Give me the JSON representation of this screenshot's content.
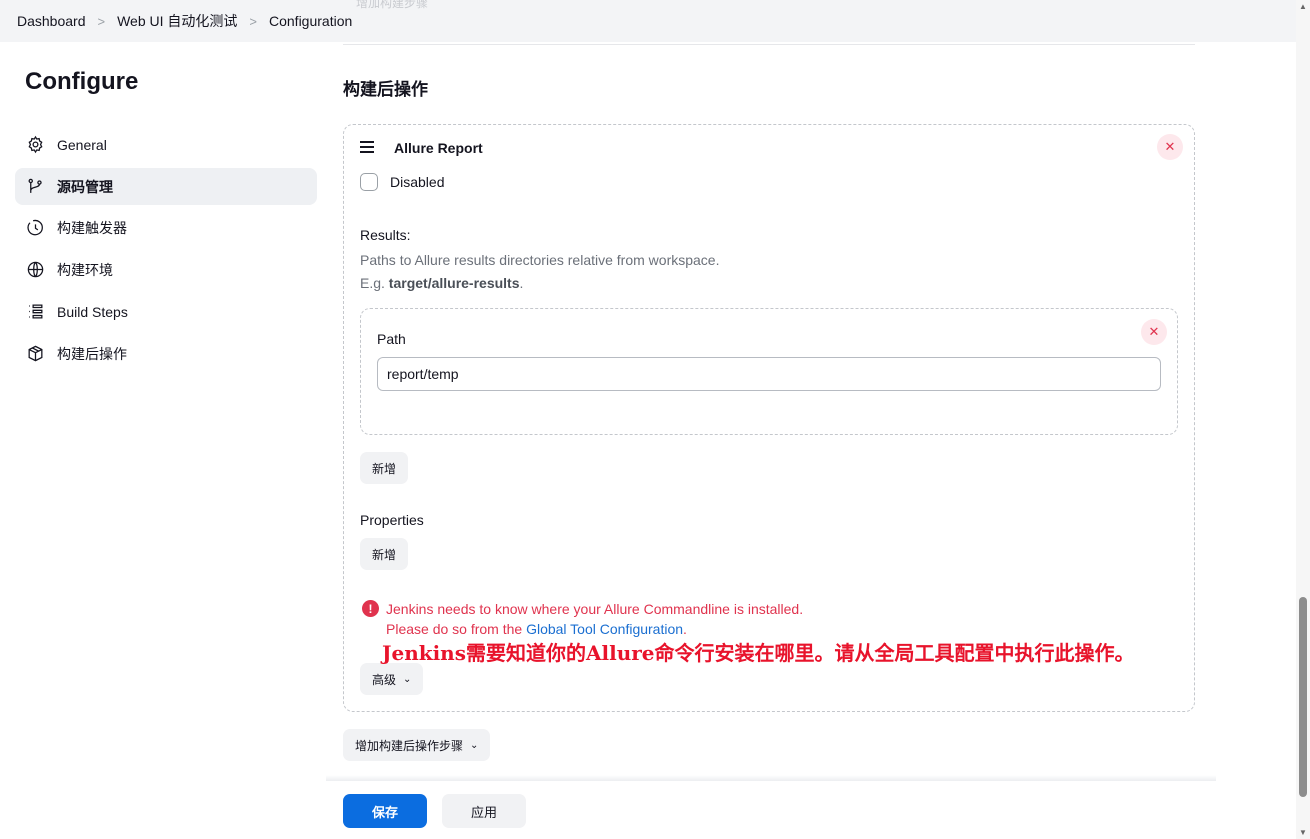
{
  "breadcrumb": {
    "items": [
      "Dashboard",
      "Web UI 自动化测试",
      "Configuration"
    ],
    "separator": ">"
  },
  "top_faint_text": "增加构建步骤",
  "sidebar": {
    "title": "Configure",
    "items": [
      {
        "label": "General",
        "icon": "gear-icon",
        "active": false
      },
      {
        "label": "源码管理",
        "icon": "branch-icon",
        "active": true
      },
      {
        "label": "构建触发器",
        "icon": "clock-icon",
        "active": false
      },
      {
        "label": "构建环境",
        "icon": "globe-icon",
        "active": false
      },
      {
        "label": "Build Steps",
        "icon": "list-icon",
        "active": false
      },
      {
        "label": "构建后操作",
        "icon": "package-icon",
        "active": false
      }
    ]
  },
  "main": {
    "section_title": "构建后操作",
    "allure": {
      "title": "Allure Report",
      "disabled_label": "Disabled",
      "disabled_checked": false,
      "results_label": "Results:",
      "results_help": "Paths to Allure results directories relative from workspace.",
      "example_prefix": "E.g. ",
      "example_value": "target/allure-results",
      "example_suffix": ".",
      "path_label": "Path",
      "path_value": "report/temp",
      "add_path_button": "新增",
      "properties_label": "Properties",
      "add_property_button": "新增",
      "error_line1": "Jenkins needs to know where your Allure Commandline is installed.",
      "error_line2_prefix": "Please do so from the ",
      "error_link": "Global Tool Configuration",
      "error_line2_suffix": ".",
      "advanced_button": "高级"
    },
    "annotation": "Jenkins需要知道你的Allure命令行安装在哪里。请从全局工具配置中执行此操作。",
    "add_post_build_button": "增加构建后操作步骤"
  },
  "footer": {
    "save_label": "保存",
    "apply_label": "应用"
  },
  "colors": {
    "primary": "#0b6de0",
    "error": "#e0334e",
    "annotation": "#e8132b",
    "link": "#1b6fd1"
  }
}
